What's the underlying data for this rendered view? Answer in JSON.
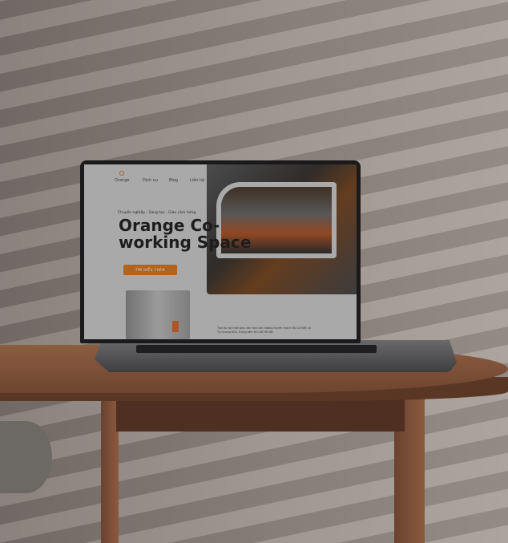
{
  "website": {
    "logo_label": "Orange",
    "nav": [
      "Dịch vụ",
      "Blog",
      "Liên hệ"
    ],
    "tagline": "Chuyên nghiệp - Sáng tạo - Giàu cảm hứng",
    "title": "Orange Co-working Space",
    "cta_label": "TÌM HIỂU THÊM",
    "paragraph": "Tọa lạc tại một giao văn hoá con đường huyền mạch Bà Cổ Việt và Tạ Quang Bửu, trung tâm thủ đô Hà Nội",
    "accent_color": "#d97a26"
  }
}
